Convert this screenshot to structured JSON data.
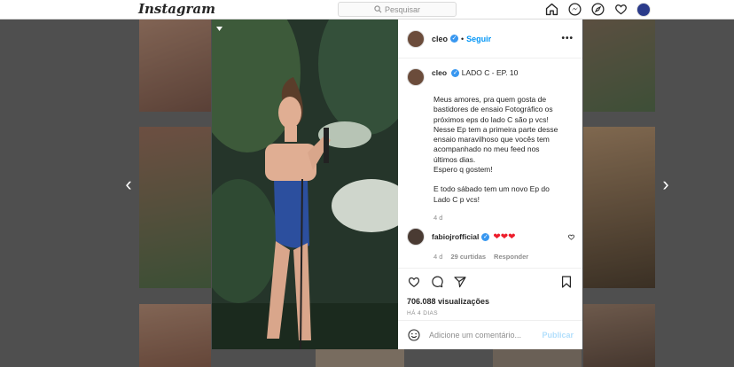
{
  "topbar": {
    "logo": "Instagram",
    "search_placeholder": "Pesquisar",
    "icons": [
      "home-icon",
      "messenger-icon",
      "explore-icon",
      "heart-icon",
      "profile-avatar"
    ]
  },
  "post": {
    "header": {
      "username": "cleo",
      "follow_label": "Seguir",
      "more_label": "•••"
    },
    "caption": {
      "username": "cleo",
      "title": "LADO C - EP. 10",
      "lines": [
        "Meus amores, pra quem gosta de",
        "bastidores de ensaio Fotográfico os",
        "próximos eps do lado C são p vcs!",
        "Nesse Ep tem a primeira parte desse",
        "ensaio maravilhoso que vocês tem",
        "acompanhado no meu feed nos",
        "últimos dias.",
        "Espero q gostem!",
        "",
        "E todo sábado tem um novo Ep do",
        "Lado C p vcs!"
      ],
      "time": "4 d"
    },
    "comment": {
      "username": "fabiojrofficial",
      "text": "❤❤❤",
      "time": "4 d",
      "likes": "29 curtidas",
      "reply_label": "Responder"
    },
    "views": "706.088 visualizações",
    "posted_ago": "HÁ 4 DIAS",
    "add_comment_placeholder": "Adicione um comentário...",
    "publish_label": "Publicar"
  },
  "navigation": {
    "prev": "‹",
    "next": "›"
  },
  "colors": {
    "accent": "#0095f6",
    "verified": "#3897f0",
    "heart": "#ed1d2b",
    "overlay": "#000000"
  }
}
